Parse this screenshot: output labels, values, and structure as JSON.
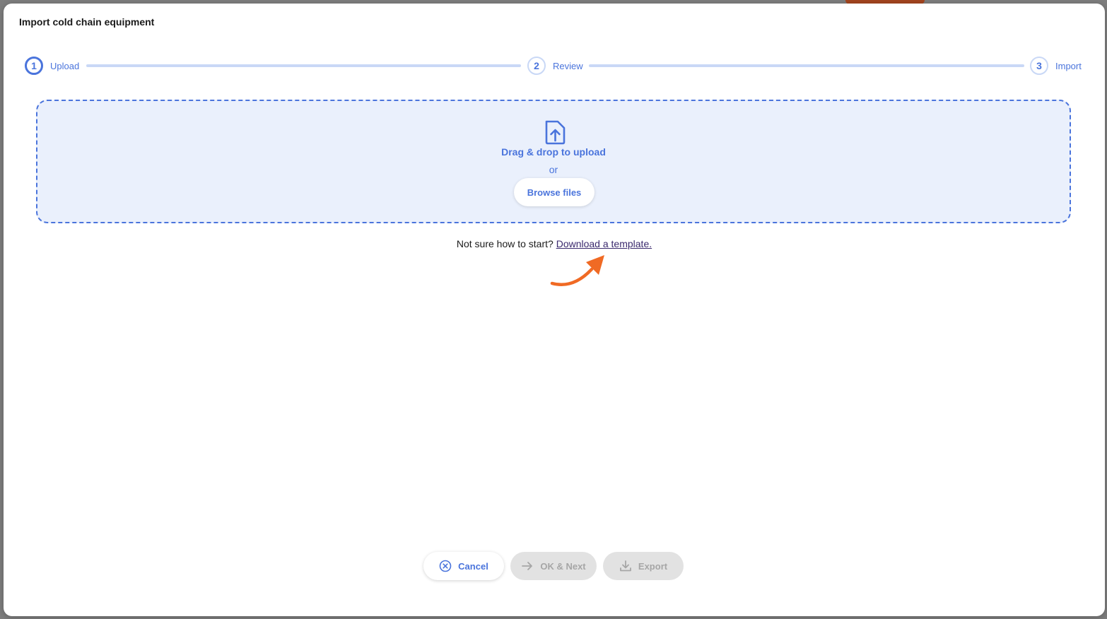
{
  "modal": {
    "title": "Import cold chain equipment"
  },
  "stepper": {
    "steps": [
      {
        "number": "1",
        "label": "Upload",
        "state": "active"
      },
      {
        "number": "2",
        "label": "Review",
        "state": "inactive"
      },
      {
        "number": "3",
        "label": "Import",
        "state": "inactive"
      }
    ]
  },
  "dropzone": {
    "icon": "file-upload-icon",
    "title": "Drag & drop to upload",
    "or_text": "or",
    "browse_label": "Browse files"
  },
  "hint": {
    "text": "Not sure how to start?",
    "link_label": "Download a template."
  },
  "footer": {
    "cancel_label": "Cancel",
    "next_label": "OK & Next",
    "export_label": "Export"
  },
  "colors": {
    "accent": "#4a74dc",
    "dropzone_bg": "#eaf0fc",
    "arrow": "#f06a24",
    "disabled_bg": "#e2e2e2"
  }
}
